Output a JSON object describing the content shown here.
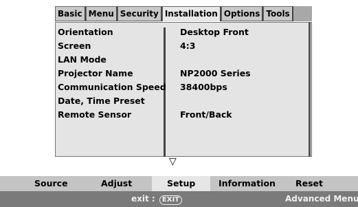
{
  "tabs": [
    {
      "label": "Basic"
    },
    {
      "label": "Menu"
    },
    {
      "label": "Security"
    },
    {
      "label": "Installation",
      "active": true
    },
    {
      "label": "Options"
    },
    {
      "label": "Tools"
    }
  ],
  "settings": [
    {
      "label": "Orientation",
      "value": "Desktop Front"
    },
    {
      "label": "Screen",
      "value": "4:3"
    },
    {
      "label": "LAN Mode",
      "value": ""
    },
    {
      "label": "Projector Name",
      "value": "NP2000 Series"
    },
    {
      "label": "Communication Speed",
      "value": "38400bps"
    },
    {
      "label": "Date, Time Preset",
      "value": ""
    },
    {
      "label": "Remote Sensor",
      "value": "Front/Back"
    }
  ],
  "scroll_indicator": "▽",
  "menubar": {
    "items": [
      {
        "label": "Source"
      },
      {
        "label": "Adjust"
      },
      {
        "label": "Setup",
        "active": true
      },
      {
        "label": "Information"
      },
      {
        "label": "Reset"
      }
    ]
  },
  "statusbar": {
    "exit_label": "exit :",
    "exit_key": "EXIT",
    "advanced_menu": "Advanced Menu"
  }
}
